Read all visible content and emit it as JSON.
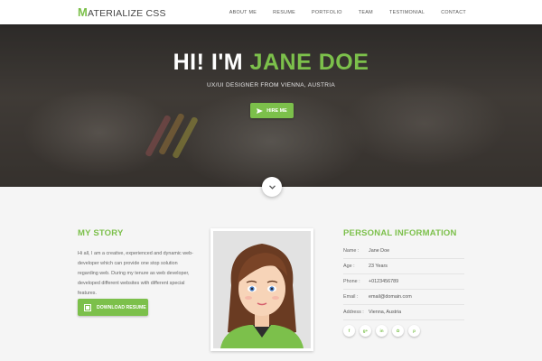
{
  "brand": {
    "first_letter": "M",
    "rest": "ATERIALIZE CSS"
  },
  "nav": {
    "items": [
      "ABOUT ME",
      "RESUME",
      "PORTFOLIO",
      "TEAM",
      "TESTIMONIAL",
      "CONTACT"
    ]
  },
  "hero": {
    "greeting": "HI! I'M ",
    "name": "JANE DOE",
    "subtitle": "UX/UI DESIGNER FROM VIENNA, AUSTRIA",
    "hire_label": "HIRE ME",
    "hire_icon": "send-icon",
    "scroll_icon": "chevron-down-icon"
  },
  "story": {
    "title": "MY STORY",
    "text": "Hi all, I am a creative, experienced and dynamic web-developer which can provide one stop solution regarding web. During my tenure as web developer, developed different websites with different special features.",
    "download_label": "DOWNLOAD RESUME"
  },
  "info": {
    "title": "PERSONAL INFORMATION",
    "rows": [
      {
        "key": "Name :",
        "value": "Jane Doe"
      },
      {
        "key": "Age :",
        "value": "23 Years"
      },
      {
        "key": "Phone :",
        "value": "+0123456789"
      },
      {
        "key": "Email :",
        "value": "email@domain.com"
      },
      {
        "key": "Address :",
        "value": "Vienna, Austria"
      }
    ],
    "socials": [
      {
        "label": "f",
        "icon": "facebook-icon"
      },
      {
        "label": "g+",
        "icon": "google-plus-icon"
      },
      {
        "label": "in",
        "icon": "linkedin-icon"
      },
      {
        "label": "✿",
        "icon": "flickr-icon"
      },
      {
        "label": "p",
        "icon": "pinterest-icon"
      }
    ]
  },
  "colors": {
    "accent": "#7cc04b",
    "background": "#f5f5f5",
    "navbar": "#ffffff"
  }
}
